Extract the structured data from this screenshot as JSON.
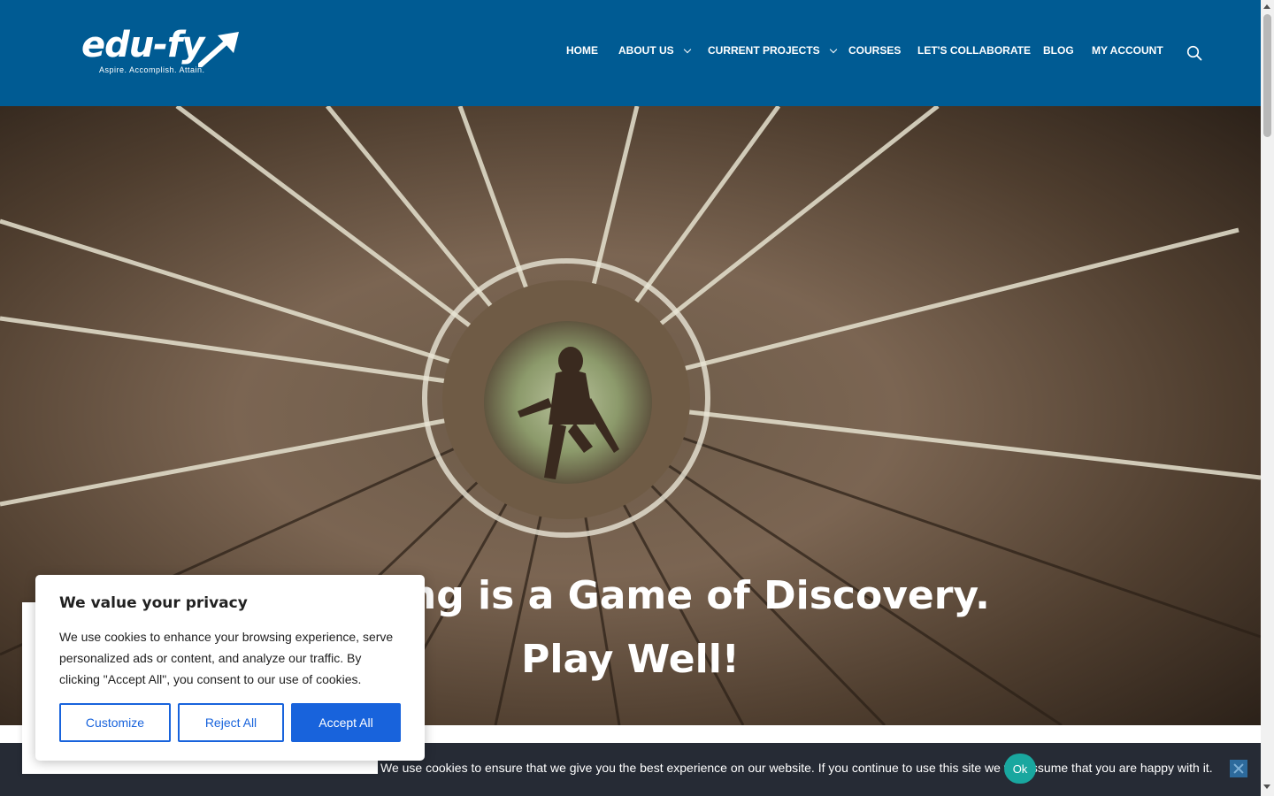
{
  "header": {
    "logo": {
      "text": "edu-fy",
      "tagline": "Aspire. Accomplish. Attain."
    },
    "nav": [
      {
        "label": "HOME",
        "dropdown": false
      },
      {
        "label": "ABOUT US",
        "dropdown": true
      },
      {
        "label": "CURRENT PROJECTS",
        "dropdown": true
      },
      {
        "label": "COURSES",
        "dropdown": false
      },
      {
        "label": "LET'S COLLABORATE",
        "dropdown": false
      },
      {
        "label": "BLOG",
        "dropdown": false
      },
      {
        "label": "MY ACCOUNT",
        "dropdown": false
      }
    ],
    "search_icon": "search-icon",
    "background_color": "#005b93"
  },
  "hero": {
    "line1": "Learning is a Game of Discovery.",
    "line2": "Play Well!"
  },
  "cookie_banner": {
    "title": "We value your privacy",
    "text": "We use cookies to enhance your browsing experience, serve personalized ads or content, and analyze our traffic. By clicking \"Accept All\", you consent to our use of cookies.",
    "customize_label": "Customize",
    "reject_label": "Reject All",
    "accept_label": "Accept All",
    "accent_color": "#1863dc"
  },
  "notice_bar": {
    "text": "We use cookies to ensure that we give you the best experience on our website. If you continue to use this site we will assume that you are happy with it.",
    "ok_label": "Ok",
    "close_icon": "close-icon"
  }
}
